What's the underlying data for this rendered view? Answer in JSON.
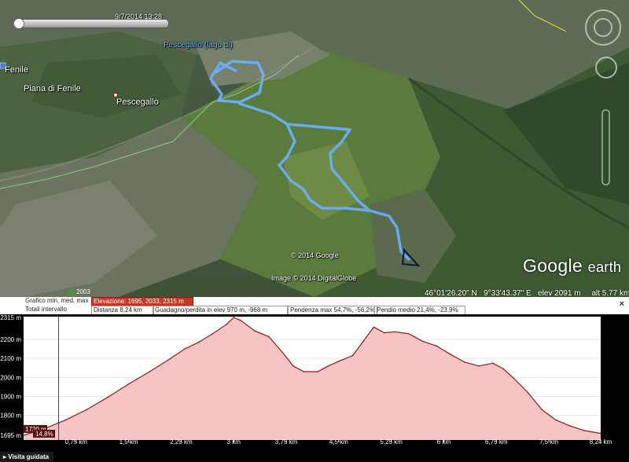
{
  "map": {
    "tour_time": "9/7/2014 13:28",
    "labels": {
      "lake": "Pescegallo (lago di)",
      "fenile": "Fenile",
      "piana": "Piana di Fenile",
      "pescegallo": "Pescegallo"
    },
    "copyright": "© 2014 Google",
    "imagery": "Image © 2014 DigitalGlobe",
    "imagery_year": "2003",
    "logo_google": "Google",
    "logo_earth": "earth",
    "status": {
      "lat": "46°01'26.20\" N",
      "lon": "9°33'43.37\" E",
      "elev": "elev  2091 m",
      "alt": "alt  5.77 km"
    },
    "track_color": "#6aaef7"
  },
  "profile": {
    "row1": {
      "graph_label": "Grafico  min, med, max",
      "elevation": "Elevazione: 1695, 2033, 2315 m"
    },
    "row2": {
      "totals": "Totali intervallo",
      "distance": "Distanza  8,24 km",
      "gain": "Guadagno/perdita in elev   970 m, -968 m",
      "slope_max": "Pendenza max  54,7%, -56,2%",
      "slope_avg": "Pendio medio  21,4%, -23,9%"
    },
    "close": "×",
    "guided_tour": "Visita guidata",
    "cursor_elev": "1720 m",
    "cursor_slope": "14,8%",
    "fill_color": "#f6c4c4",
    "line_color": "#8b1a1a"
  },
  "chart_data": {
    "type": "area",
    "xlabel": "",
    "ylabel": "",
    "x_ticks": [
      "0,75 km",
      "1,5 km",
      "2,25 km",
      "3 km",
      "3,75 km",
      "4,5 km",
      "5,25 km",
      "6 km",
      "6,75 km",
      "7,5 km",
      "8,24 km"
    ],
    "y_ticks": [
      "2315 m",
      "2200 m",
      "2100 m",
      "2000 m",
      "1900 m",
      "1800 m",
      "1695 m"
    ],
    "xlim": [
      0,
      8.24
    ],
    "ylim": [
      1670,
      2320
    ],
    "x": [
      0,
      0.3,
      0.6,
      0.9,
      1.2,
      1.5,
      1.8,
      2.1,
      2.3,
      2.5,
      2.7,
      2.9,
      3.0,
      3.1,
      3.3,
      3.5,
      3.7,
      3.85,
      4.0,
      4.2,
      4.35,
      4.5,
      4.7,
      4.85,
      5.0,
      5.15,
      5.3,
      5.5,
      5.7,
      5.9,
      6.1,
      6.3,
      6.5,
      6.7,
      6.85,
      7.0,
      7.2,
      7.4,
      7.6,
      7.8,
      8.0,
      8.24
    ],
    "y": [
      1695,
      1730,
      1775,
      1830,
      1895,
      1965,
      2030,
      2100,
      2150,
      2185,
      2230,
      2280,
      2315,
      2300,
      2245,
      2215,
      2130,
      2060,
      2030,
      2030,
      2060,
      2085,
      2115,
      2190,
      2265,
      2235,
      2240,
      2230,
      2190,
      2165,
      2120,
      2080,
      2060,
      2075,
      2045,
      1995,
      1920,
      1830,
      1775,
      1745,
      1720,
      1705
    ]
  }
}
